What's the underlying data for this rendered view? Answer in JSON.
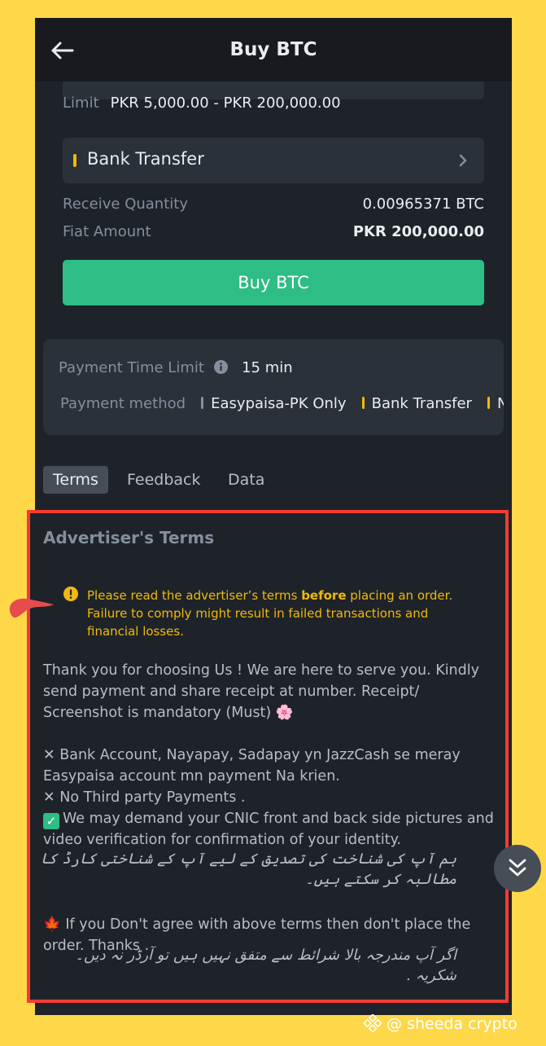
{
  "header": {
    "title": "Buy BTC"
  },
  "order": {
    "limit_label": "Limit",
    "limit_value": "PKR 5,000.00 - PKR 200,000.00",
    "payment_selected": "Bank Transfer",
    "receive_label": "Receive Quantity",
    "receive_value": "0.00965371 BTC",
    "fiat_label": "Fiat Amount",
    "fiat_value": "PKR 200,000.00",
    "buy_button": "Buy BTC"
  },
  "info": {
    "time_limit_label": "Payment Time Limit",
    "time_limit_value": "15 min",
    "method_label": "Payment method",
    "methods": [
      {
        "label": "Easypaisa-PK Only",
        "color": "#848E9C"
      },
      {
        "label": "Bank Transfer",
        "color": "#F0B90B"
      },
      {
        "label": "Na",
        "color": "#F0B90B"
      }
    ]
  },
  "tabs": [
    "Terms",
    "Feedback",
    "Data"
  ],
  "active_tab": "Terms",
  "terms": {
    "heading": "Advertiser's Terms",
    "warning_pre": "Please read the advertiser’s terms ",
    "warning_bold": "before",
    "warning_post": " placing an order. Failure to comply might result in failed transactions and financial losses.",
    "para1": "Thank you for choosing Us ! We are here to serve you. Kindly send payment and share receipt at number. Receipt/ Screenshot is mandatory (Must)",
    "para1_emoji": "🌸",
    "line_no_bank": "✕ Bank Account, Nayapay, Sadapay yn JazzCash se meray Easypaisa account mn payment Na krien.",
    "line_no_third": "✕ No Third party Payments .",
    "line_cnic": "We may demand your CNIC front and back side pictures and video verification for confirmation of your identity.",
    "check_glyph": "✓",
    "urdu_1": "ہم آپ کی شناخت کی تصدیق کے لیے آپ کے شناختی کارڈ کا مطالبہ کر سکتے ہیں۔",
    "leaf_glyph": "🍁",
    "para_disagree": "If you Don't agree with above terms then don't place the order. Thanks .",
    "urdu_2": "اگر آپ مندرجہ بالا شرائط سے متفق نہیں ہیں تو آرڈر نہ دیں۔ شکریہ ."
  },
  "watermark": "@ sheeda crypto",
  "colors": {
    "accent_yellow": "#F0B90B",
    "buy_green": "#2EBD85",
    "highlight_red": "#F63A34",
    "frame_yellow": "#FFD84A"
  }
}
